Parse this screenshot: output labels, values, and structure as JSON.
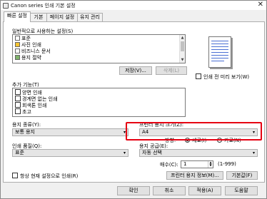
{
  "window": {
    "title": "Canon series 인쇄 기본 설정",
    "close_glyph": "✕"
  },
  "tabs": [
    "빠른 설정",
    "기본",
    "페이지 설정",
    "유지 관리"
  ],
  "presets": {
    "label": "일반적으로 사용하는 설정(S)",
    "items": [
      "표준",
      "사진 인쇄",
      "비즈니스 문서",
      "용지 절약"
    ],
    "save_button": "저장(V)...",
    "delete_button": "삭제(L)"
  },
  "preview": {
    "show_before_print_label": "인쇄 전 미리 보기(W)"
  },
  "additional": {
    "label": "추가 기능(T)",
    "options": [
      "양면 인쇄",
      "경계면 없는 인쇄",
      "회색톤 인쇄",
      "초고"
    ]
  },
  "media_type": {
    "label": "용지 종류(Y):",
    "value": "보통 용지"
  },
  "printer_paper_size": {
    "label": "프린터 용지 크기(Z):",
    "value": "A4"
  },
  "orientation": {
    "label": "방향:",
    "portrait": "세로(I)",
    "landscape": "가로(N)",
    "selected": "portrait"
  },
  "print_quality": {
    "label": "인쇄 품질(Q):",
    "value": "표준"
  },
  "paper_source": {
    "label": "용지 공급(E):",
    "value": "자동 선택"
  },
  "copies": {
    "label": "매수(C):",
    "value": "1",
    "range": "(1-999)"
  },
  "always_print_label": "항상 현재 설정으로 인쇄(R)",
  "printer_paper_info_button": "프린터 용지 정보(M)...",
  "defaults_button": "기본값(F)",
  "footer": {
    "ok": "확인",
    "cancel": "취소",
    "apply": "적용(A)",
    "help": "도움말"
  },
  "colors": {
    "highlight": "#e60012"
  }
}
